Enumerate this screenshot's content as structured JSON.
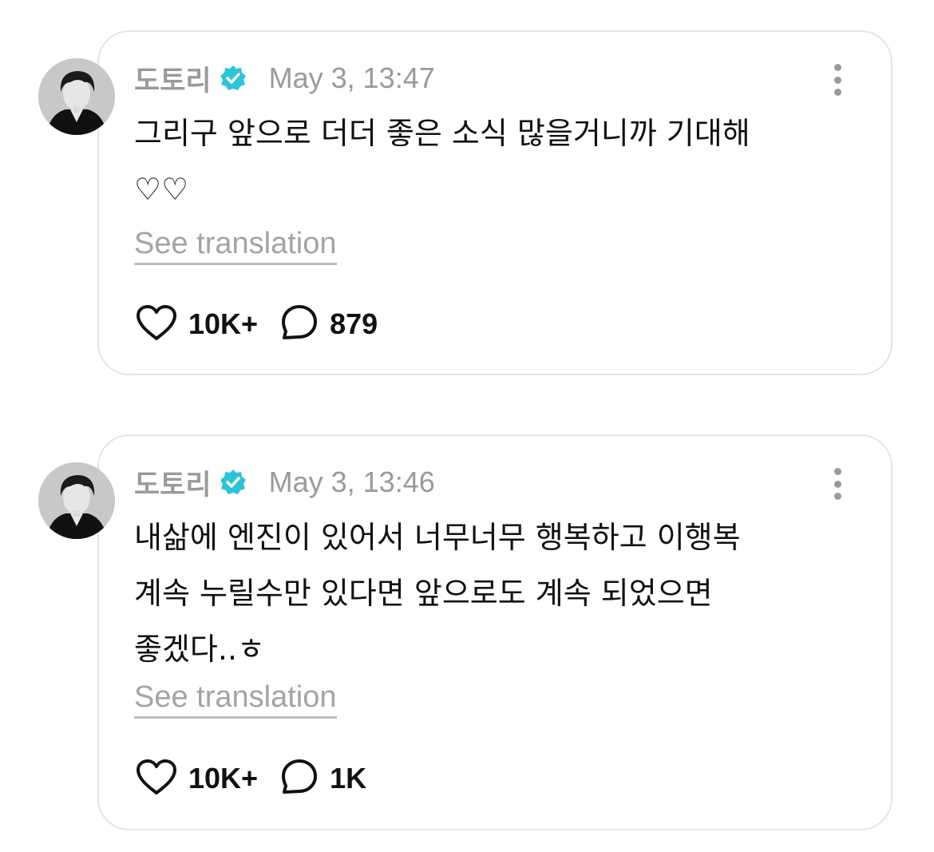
{
  "posts": [
    {
      "username": "도토리",
      "timestamp": "May 3, 13:47",
      "body": "그리구 앞으로 더더 좋은 소식 많을거니까 기대해\n♡♡",
      "see_translation": "See translation",
      "likes": "10K+",
      "comments": "879"
    },
    {
      "username": "도토리",
      "timestamp": "May 3, 13:46",
      "body": "내삶에 엔진이 있어서 너무너무 행복하고 이행복\n계속 누릴수만 있다면 앞으로도 계속 되었으면\n좋겠다..ㅎ",
      "see_translation": "See translation",
      "likes": "10K+",
      "comments": "1K"
    }
  ],
  "icons": {
    "verified": "verified-badge-icon",
    "like": "heart-icon",
    "comment": "speech-bubble-icon",
    "more": "more-options-icon"
  },
  "colors": {
    "verified_badge": "#2cc4d8",
    "muted_text": "#9a9a9a",
    "card_border": "#e4e4e4"
  }
}
